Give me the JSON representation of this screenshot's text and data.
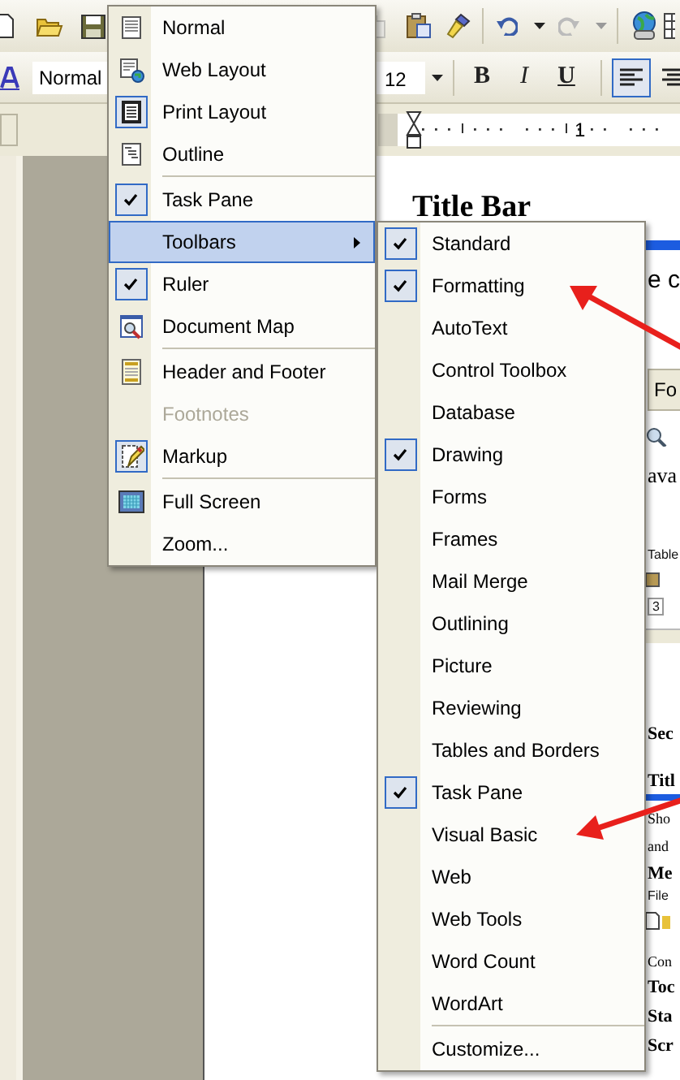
{
  "toolbar": {
    "style_field": "Normal",
    "font_size": "12",
    "format_buttons": [
      {
        "label": "B",
        "kind": "bold",
        "selected": false
      },
      {
        "label": "I",
        "kind": "italic",
        "selected": false
      },
      {
        "label": "U",
        "kind": "underline",
        "selected": false
      }
    ],
    "alignment": [
      {
        "selected": true
      },
      {
        "selected": false
      }
    ]
  },
  "ruler": {
    "number": "1"
  },
  "document": {
    "heading": "Title Bar",
    "fragments": [
      {
        "text": "e c",
        "kind": "text"
      },
      {
        "text": "Fo",
        "kind": "button"
      },
      {
        "text": "ava",
        "kind": "serif"
      },
      {
        "text": "Table",
        "kind": "tiny"
      },
      {
        "text": "3",
        "kind": "tiny"
      },
      {
        "text": "Sec",
        "kind": "heading"
      },
      {
        "text": "Titl",
        "kind": "heading"
      },
      {
        "text": "Sho",
        "kind": "body"
      },
      {
        "text": "and",
        "kind": "body"
      },
      {
        "text": "Me",
        "kind": "heading"
      },
      {
        "text": "File",
        "kind": "tiny"
      },
      {
        "text": "Con",
        "kind": "body"
      },
      {
        "text": "Toc",
        "kind": "heading"
      },
      {
        "text": "Sta",
        "kind": "heading"
      },
      {
        "text": "Scr",
        "kind": "heading"
      }
    ]
  },
  "view_menu": {
    "groups": [
      {
        "items": [
          {
            "label": "Normal",
            "kind": "icon",
            "checked": false,
            "selected": false,
            "disabled": false
          },
          {
            "label": "Web Layout",
            "kind": "icon",
            "checked": false,
            "selected": false,
            "disabled": false
          },
          {
            "label": "Print Layout",
            "kind": "icon",
            "checked": true,
            "selected": false,
            "disabled": false
          },
          {
            "label": "Outline",
            "kind": "icon",
            "checked": false,
            "selected": false,
            "disabled": false
          }
        ]
      },
      {
        "items": [
          {
            "label": "Task Pane",
            "kind": "check",
            "checked": true,
            "selected": false,
            "disabled": false
          },
          {
            "label": "Toolbars",
            "kind": "submenu",
            "checked": false,
            "selected": true,
            "disabled": false
          },
          {
            "label": "Ruler",
            "kind": "check",
            "checked": true,
            "selected": false,
            "disabled": false
          },
          {
            "label": "Document Map",
            "kind": "icon",
            "checked": false,
            "selected": false,
            "disabled": false
          }
        ]
      },
      {
        "items": [
          {
            "label": "Header and Footer",
            "kind": "icon",
            "checked": false,
            "selected": false,
            "disabled": false
          },
          {
            "label": "Footnotes",
            "kind": "plain",
            "checked": false,
            "selected": false,
            "disabled": true
          },
          {
            "label": "Markup",
            "kind": "icon",
            "checked": true,
            "selected": false,
            "disabled": false
          }
        ]
      },
      {
        "items": [
          {
            "label": "Full Screen",
            "kind": "icon",
            "checked": false,
            "selected": false,
            "disabled": false
          },
          {
            "label": "Zoom...",
            "kind": "plain",
            "checked": false,
            "selected": false,
            "disabled": false
          }
        ]
      }
    ]
  },
  "toolbars_submenu": {
    "groups": [
      {
        "items": [
          {
            "label": "Standard",
            "checked": true
          },
          {
            "label": "Formatting",
            "checked": true
          },
          {
            "label": "AutoText",
            "checked": false
          },
          {
            "label": "Control Toolbox",
            "checked": false
          },
          {
            "label": "Database",
            "checked": false
          },
          {
            "label": "Drawing",
            "checked": true
          },
          {
            "label": "Forms",
            "checked": false
          },
          {
            "label": "Frames",
            "checked": false
          },
          {
            "label": "Mail Merge",
            "checked": false
          },
          {
            "label": "Outlining",
            "checked": false
          },
          {
            "label": "Picture",
            "checked": false
          },
          {
            "label": "Reviewing",
            "checked": false
          },
          {
            "label": "Tables and Borders",
            "checked": false
          },
          {
            "label": "Task Pane",
            "checked": true
          },
          {
            "label": "Visual Basic",
            "checked": false
          },
          {
            "label": "Web",
            "checked": false
          },
          {
            "label": "Web Tools",
            "checked": false
          },
          {
            "label": "Word Count",
            "checked": false
          },
          {
            "label": "WordArt",
            "checked": false
          }
        ]
      },
      {
        "items": [
          {
            "label": "Customize...",
            "checked": false
          }
        ]
      }
    ]
  }
}
